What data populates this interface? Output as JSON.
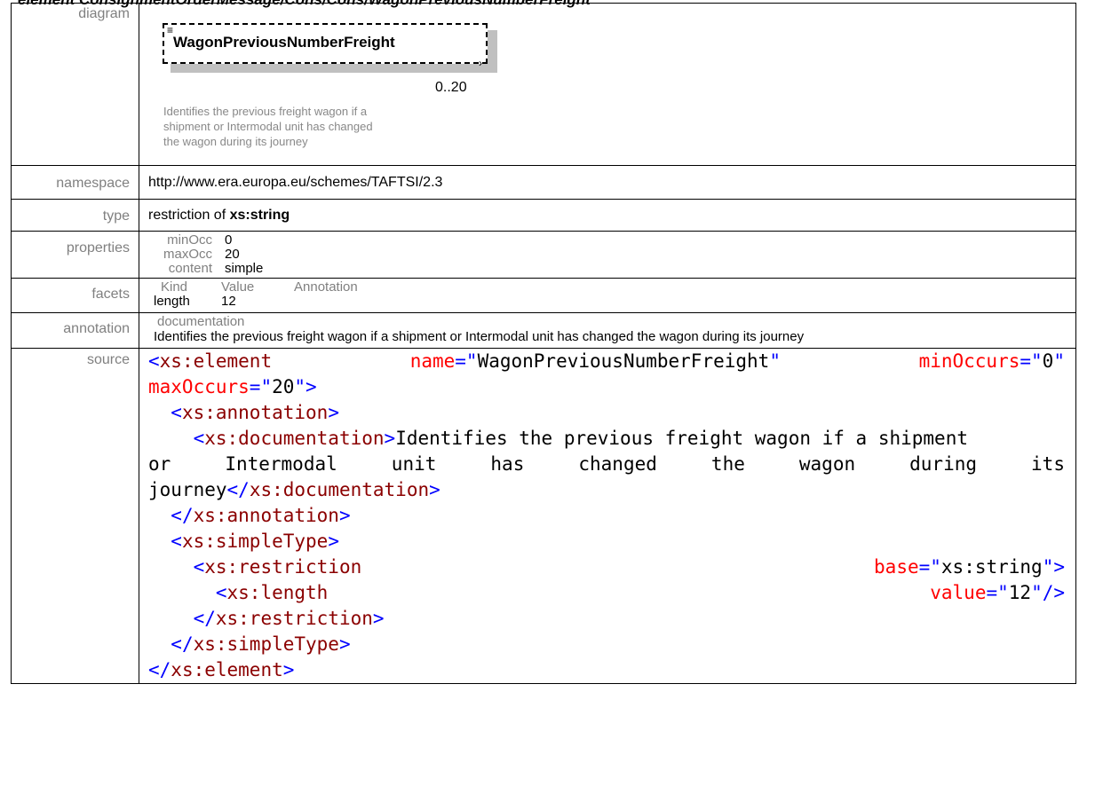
{
  "heading": "element ConsignmentOrderMessage/Cons/Cons/WagonPreviousNumberFreight",
  "labels": {
    "diagram": "diagram",
    "namespace": "namespace",
    "type": "type",
    "properties": "properties",
    "facets": "facets",
    "annotation": "annotation",
    "source": "source"
  },
  "diagram": {
    "element_name": "WagonPreviousNumberFreight",
    "occurrence": "0..20",
    "annotation_lines": [
      "Identifies the previous freight wagon if a",
      "shipment or Intermodal unit has changed",
      "the wagon during its journey"
    ]
  },
  "namespace": "http://www.era.europa.eu/schemes/TAFTSI/2.3",
  "type": {
    "prefix": "restriction of ",
    "base": "xs:string"
  },
  "properties": [
    {
      "key": "minOcc",
      "value": "0"
    },
    {
      "key": "maxOcc",
      "value": "20"
    },
    {
      "key": "content",
      "value": "simple"
    }
  ],
  "facets": {
    "headers": [
      "Kind",
      "Value",
      "Annotation"
    ],
    "rows": [
      {
        "kind": "length",
        "value": "12",
        "annotation": ""
      }
    ]
  },
  "annotation": {
    "header": "documentation",
    "text": "Identifies the previous freight wagon if a shipment or Intermodal unit has changed the wagon during its journey"
  },
  "source": {
    "l1_tag": "xs:element",
    "l1_attr1": "name",
    "l1_val1": "WagonPreviousNumberFreight",
    "l1_attr2": "minOccurs",
    "l1_val2": "0",
    "l2_attr": "maxOccurs",
    "l2_val": "20",
    "annotation_tag": "xs:annotation",
    "documentation_tag": "xs:documentation",
    "doc_words_line1": "Identifies the previous freight wagon if a shipment",
    "doc_words_line2": [
      "or",
      "Intermodal",
      "unit",
      "has",
      "changed",
      "the",
      "wagon",
      "during",
      "its"
    ],
    "doc_words_line3": "journey",
    "simpletype_tag": "xs:simpleType",
    "restriction_tag": "xs:restriction",
    "restriction_attr": "base",
    "restriction_val": "xs:string",
    "length_tag": "xs:length",
    "length_attr": "value",
    "length_val": "12"
  }
}
